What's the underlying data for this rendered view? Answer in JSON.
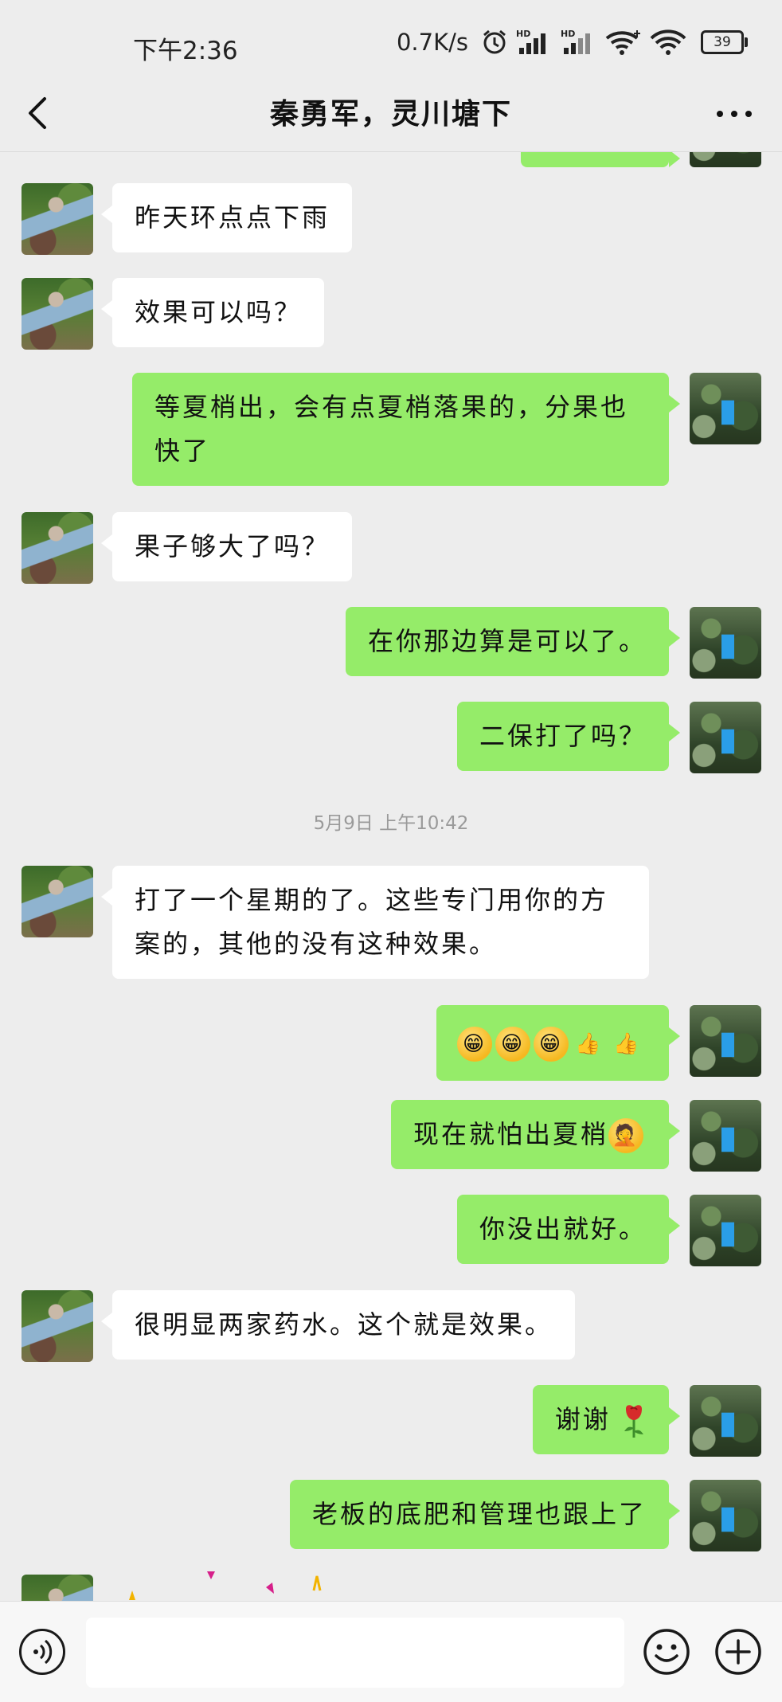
{
  "status_bar": {
    "time": "下午2:36",
    "net_speed": "0.7K/s",
    "hd_label_1": "HD",
    "hd_label_2": "HD",
    "battery": "39"
  },
  "header": {
    "title": "秦勇军，灵川塘下"
  },
  "messages": [
    {
      "side": "in",
      "text": "昨天环点点下雨"
    },
    {
      "side": "in",
      "text": "效果可以吗？"
    },
    {
      "side": "out",
      "text": "等夏梢出，会有点夏梢落果的，分果也快了"
    },
    {
      "side": "in",
      "text": "果子够大了吗？"
    },
    {
      "side": "out",
      "text": "在你那边算是可以了。"
    },
    {
      "side": "out",
      "text": "二保打了吗？"
    },
    {
      "side": "time",
      "text": "5月9日 上午10:42"
    },
    {
      "side": "in",
      "text": "打了一个星期的了。这些专门用你的方案的，其他的没有这种效果。"
    },
    {
      "side": "out",
      "text": "",
      "emojis": [
        "grin-emoji",
        "grin-emoji",
        "grin-emoji",
        "thumbs-up-emoji",
        "thumbs-up-emoji"
      ]
    },
    {
      "side": "out",
      "text": "现在就怕出夏梢",
      "emojis": [
        "facepalm-emoji"
      ]
    },
    {
      "side": "out",
      "text": "你没出就好。"
    },
    {
      "side": "in",
      "text": "很明显两家药水。这个就是效果。"
    },
    {
      "side": "out",
      "text": "谢谢",
      "emojis": [
        "rose-emoji"
      ]
    },
    {
      "side": "out",
      "text": "老板的底肥和管理也跟上了"
    }
  ],
  "input": {
    "placeholder": ""
  },
  "colors": {
    "background": "#ededed",
    "outgoing_bubble": "#95ec69",
    "incoming_bubble": "#ffffff"
  }
}
